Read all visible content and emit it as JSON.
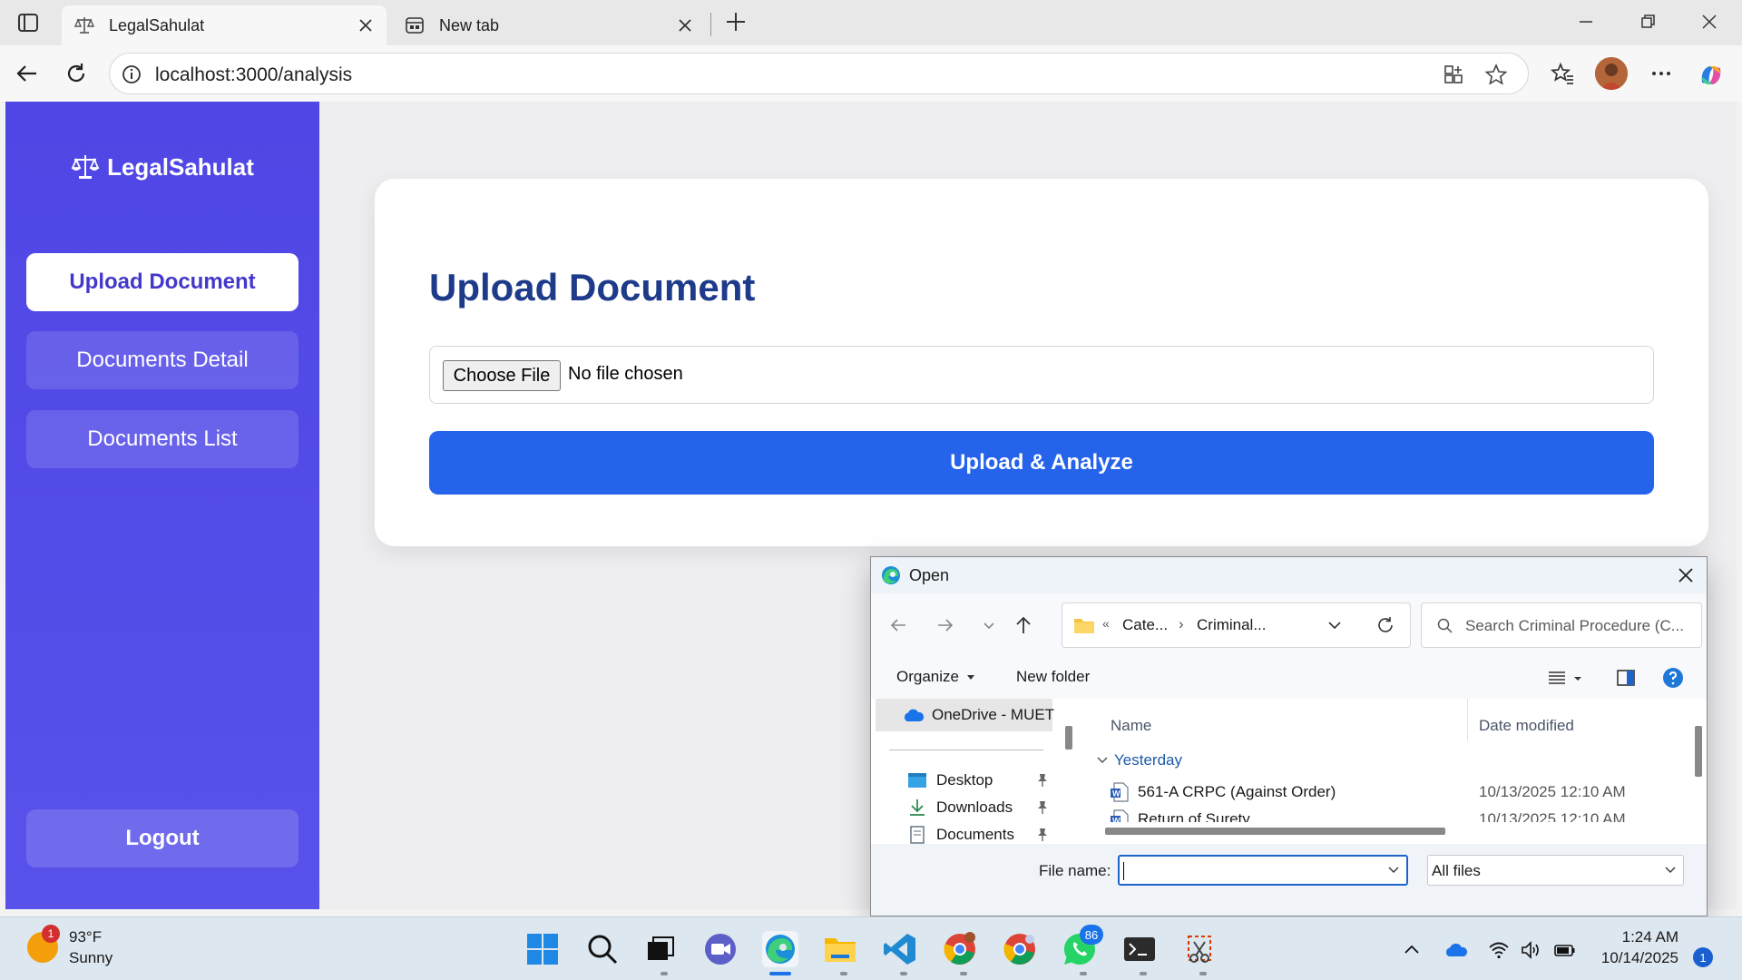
{
  "browser": {
    "tabs": [
      {
        "title": "LegalSahulat",
        "icon": "scales-icon",
        "active": true
      },
      {
        "title": "New tab",
        "icon": "newtab-page-icon",
        "active": false
      }
    ],
    "url": "localhost:3000/analysis"
  },
  "app": {
    "brand": "LegalSahulat",
    "nav": [
      {
        "label": "Upload Document",
        "active": true
      },
      {
        "label": "Documents Detail",
        "active": false
      },
      {
        "label": "Documents List",
        "active": false
      }
    ],
    "logout_label": "Logout",
    "page_title": "Upload Document",
    "file_input": {
      "button_label": "Choose File",
      "status": "No file chosen"
    },
    "submit_label": "Upload & Analyze",
    "colors": {
      "sidebar": "#4f46e5",
      "primary_button": "#2563eb",
      "title": "#1e3a8a"
    }
  },
  "dialog": {
    "title": "Open",
    "breadcrumb": {
      "prefix": "«",
      "items": [
        "Cate...",
        "Criminal..."
      ]
    },
    "search_placeholder": "Search Criminal Procedure (C...",
    "organize_label": "Organize",
    "new_folder_label": "New folder",
    "nav_pane": {
      "onedrive": "OneDrive - MUET",
      "quick_access": [
        "Desktop",
        "Downloads",
        "Documents"
      ]
    },
    "columns": {
      "name": "Name",
      "date": "Date modified"
    },
    "group": "Yesterday",
    "files": [
      {
        "name": "561-A CRPC (Against Order)",
        "date": "10/13/2025 12:10 AM"
      },
      {
        "name": "Return of Surety",
        "date": "10/13/2025 12:10 AM"
      }
    ],
    "file_name_label": "File name:",
    "file_name_value": "",
    "file_type": "All files"
  },
  "taskbar": {
    "weather": {
      "temp": "93°F",
      "condition": "Sunny",
      "badge": "1"
    },
    "whatsapp_badge": "86",
    "time": "1:24 AM",
    "date": "10/14/2025",
    "notification_count": "1"
  }
}
